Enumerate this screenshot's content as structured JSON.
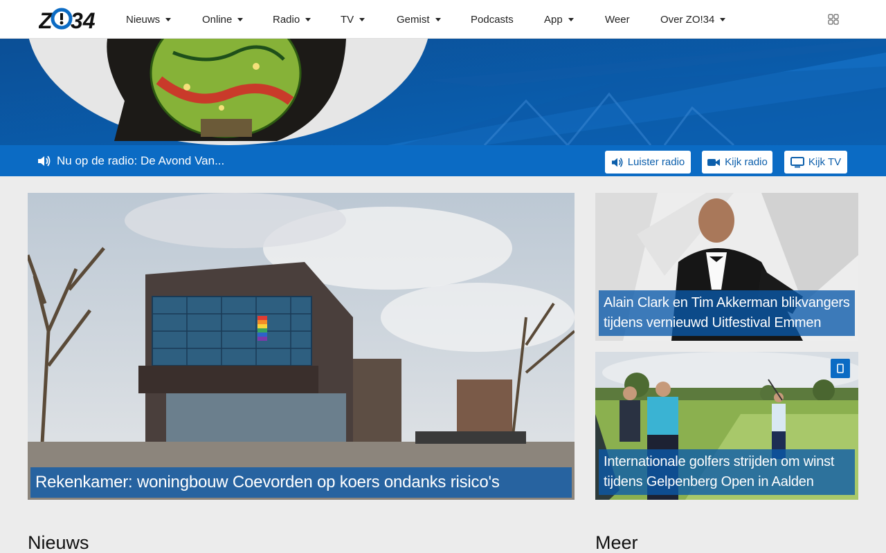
{
  "brand": {
    "logo_text": "ZO!34",
    "primary": "#0b6bc4",
    "dark": "#0a5fad"
  },
  "nav": {
    "items": [
      {
        "label": "Nieuws",
        "dropdown": true
      },
      {
        "label": "Online",
        "dropdown": true
      },
      {
        "label": "Radio",
        "dropdown": true
      },
      {
        "label": "TV",
        "dropdown": true
      },
      {
        "label": "Gemist",
        "dropdown": true
      },
      {
        "label": "Podcasts",
        "dropdown": false
      },
      {
        "label": "App",
        "dropdown": true
      },
      {
        "label": "Weer",
        "dropdown": false
      },
      {
        "label": "Over ZO!34",
        "dropdown": true
      }
    ],
    "apps_icon": "grid-icon"
  },
  "radio_bar": {
    "now_playing": "Nu op de radio: De Avond Van...",
    "buttons": {
      "listen": "Luister radio",
      "watch_radio": "Kijk radio",
      "watch_tv": "Kijk TV"
    }
  },
  "featured": {
    "main": {
      "title": "Rekenkamer: woningbouw Coevorden op koers ondanks risico's"
    },
    "side": [
      {
        "title": "Alain Clark en Tim Akkerman blikvangers tijdens vernieuwd Uitfestival Emmen",
        "video": false
      },
      {
        "title": "Internationale golfers strijden om winst tijdens Gelpenberg Open in Aalden",
        "video": true,
        "badge_icon": "video-icon"
      }
    ]
  },
  "sections": {
    "news": "Nieuws",
    "more": "Meer"
  }
}
